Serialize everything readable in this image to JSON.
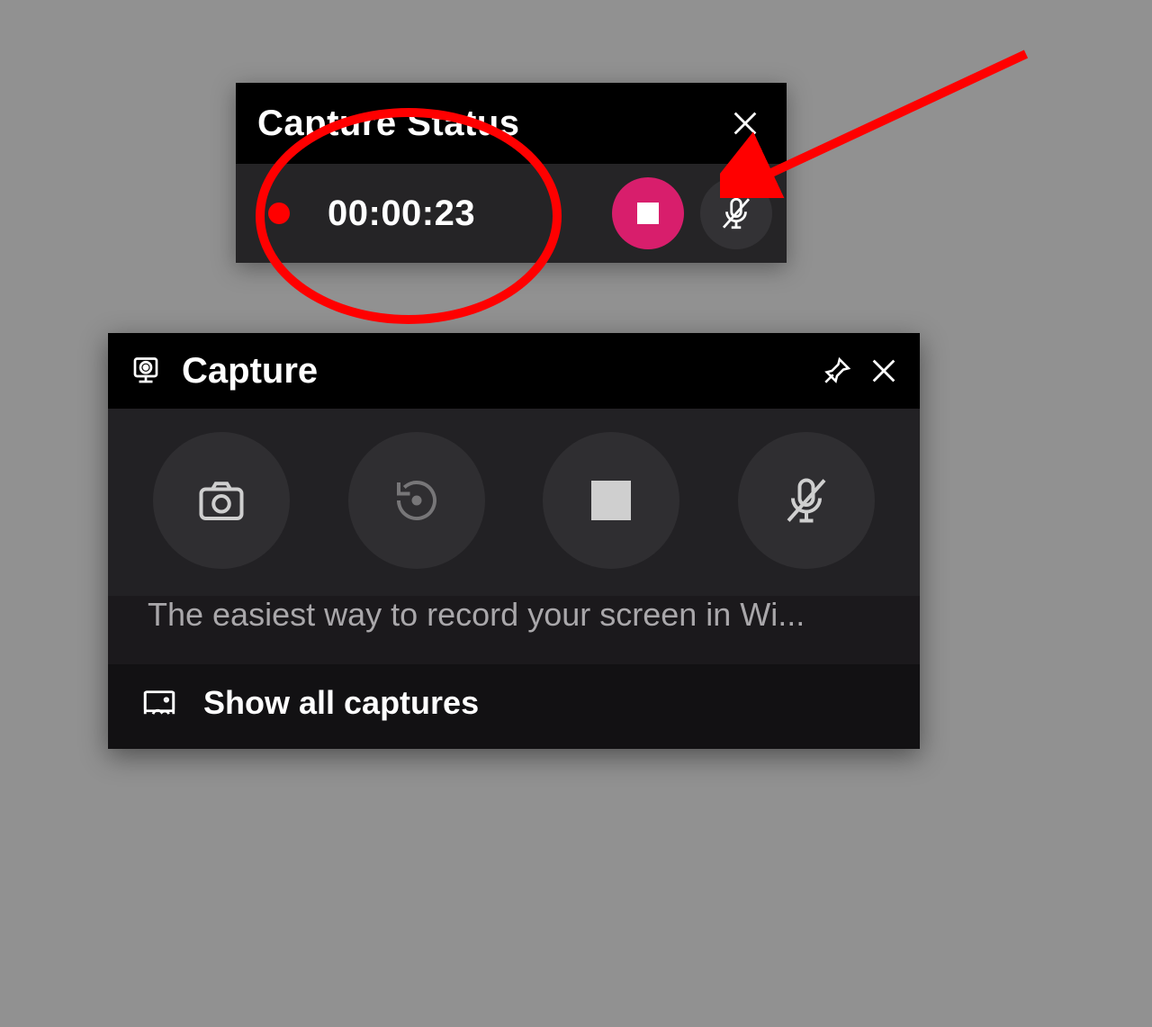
{
  "status_panel": {
    "title": "Capture Status",
    "elapsed": "00:00:23"
  },
  "capture_panel": {
    "title": "Capture",
    "current_target": "The easiest way to record your screen in Wi...",
    "footer_label": "Show all captures"
  },
  "colors": {
    "accent_stop": "#d81e6c",
    "annotation": "#ff0000"
  }
}
